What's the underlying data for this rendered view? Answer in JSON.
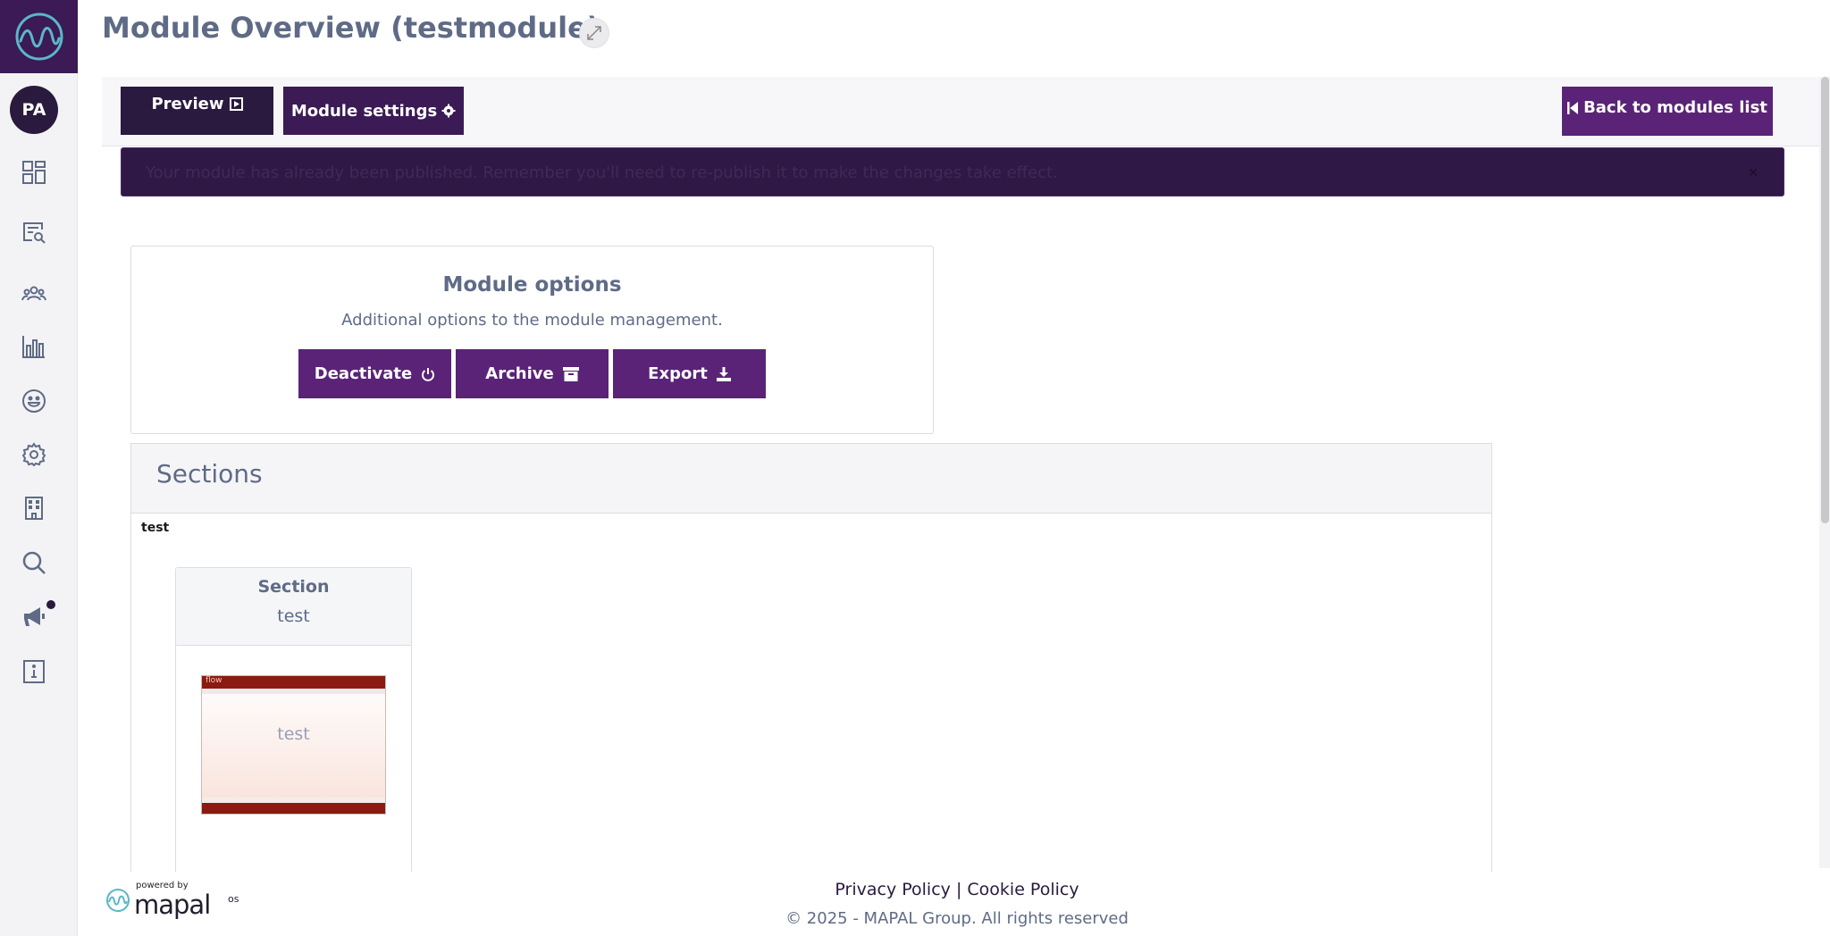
{
  "sidebar": {
    "avatar_initials": "PA",
    "nav_icons": [
      "dashboard-icon",
      "search-document-icon",
      "users-icon",
      "chart-icon",
      "smiley-icon",
      "gear-icon",
      "building-icon",
      "search-icon",
      "megaphone-icon",
      "info-icon"
    ]
  },
  "header": {
    "title": "Module Overview (testmodule)"
  },
  "toolbar": {
    "preview_label": "Preview",
    "settings_label": "Module settings",
    "back_label": "Back to modules list"
  },
  "notice": {
    "text": "Your module has already been published. Remember you'll need to re-publish it to make the changes take effect."
  },
  "options": {
    "title": "Module options",
    "subtitle": "Additional options to the module management.",
    "deactivate_label": "Deactivate",
    "archive_label": "Archive",
    "export_label": "Export"
  },
  "sections": {
    "title": "Sections",
    "group_label": "test",
    "card": {
      "title": "Section",
      "subtitle": "test",
      "thumbnail_label": "test",
      "thumbnail_brand": "flow"
    }
  },
  "footer": {
    "powered_by": "powered by",
    "brand": "mapal",
    "brand_suffix": "os",
    "privacy": "Privacy Policy",
    "separator": "|",
    "cookie": "Cookie Policy",
    "copyright": "© 2025 - MAPAL Group. All rights reserved"
  },
  "colors": {
    "sidebar_logo_bg": "#3b1a55",
    "primary_button": "#5a2377",
    "dark_button": "#2b1a3f",
    "notice_bg": "#2f1845",
    "text": "#5f6b86"
  }
}
